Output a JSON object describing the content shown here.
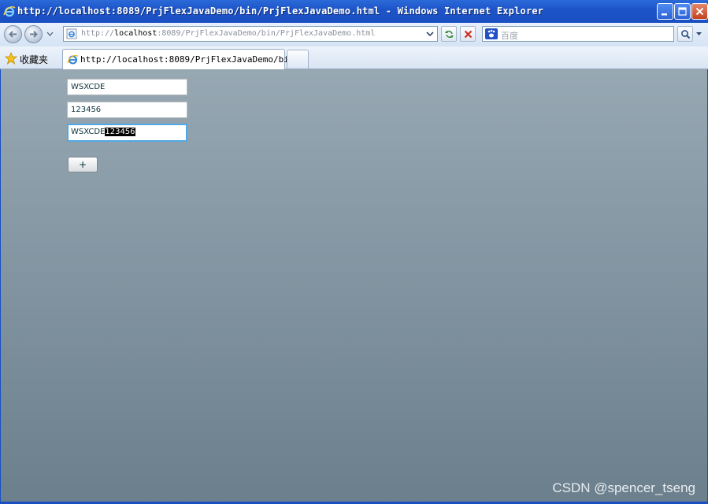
{
  "window": {
    "title": "http://localhost:8089/PrjFlexJavaDemo/bin/PrjFlexJavaDemo.html - Windows Internet Explorer"
  },
  "address_bar": {
    "url_prefix": "http://",
    "url_host": "localhost",
    "url_rest": ":8089/PrjFlexJavaDemo/bin/PrjFlexJavaDemo.html"
  },
  "search": {
    "placeholder": "百度"
  },
  "favorites": {
    "label": "收藏夹"
  },
  "tabs": [
    {
      "label": "http://localhost:8089/PrjFlexJavaDemo/bin..."
    }
  ],
  "form": {
    "field1_value": "WSXCDE",
    "field2_value": "123456",
    "result_prefix": "WSXCDE",
    "result_selected": "123456",
    "add_button_label": "+"
  },
  "watermark": "CSDN @spencer_tseng",
  "colors": {
    "titlebar": "#1d55c9",
    "content_top": "#97a8b3",
    "content_bottom": "#6b7f8d",
    "focus_border": "#52a8e5"
  }
}
